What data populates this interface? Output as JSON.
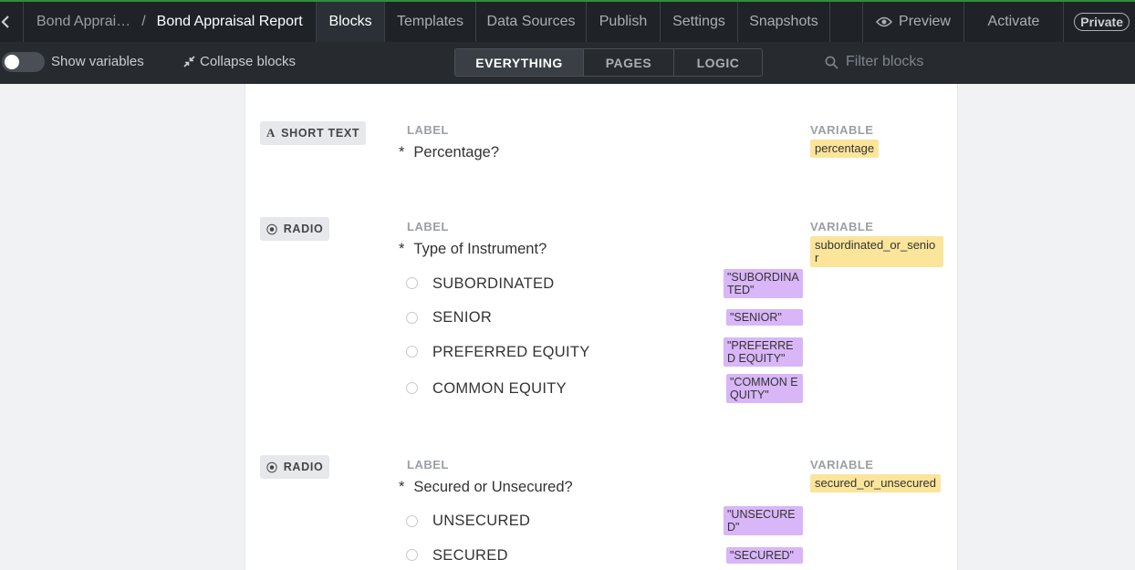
{
  "topbar": {
    "breadcrumb_parent": "Bond Apprai…",
    "breadcrumb_separator": "/",
    "breadcrumb_current": "Bond Appraisal Report",
    "tabs": [
      {
        "label": "Blocks",
        "active": true
      },
      {
        "label": "Templates"
      },
      {
        "label": "Data Sources"
      },
      {
        "label": "Publish"
      },
      {
        "label": "Settings"
      },
      {
        "label": "Snapshots"
      }
    ],
    "preview_label": "Preview",
    "activate_label": "Activate",
    "privacy_badge": "Private"
  },
  "subbar": {
    "show_variables_label": "Show variables",
    "show_variables_on": false,
    "collapse_label": "Collapse blocks",
    "views": [
      {
        "label": "EVERYTHING",
        "active": true
      },
      {
        "label": "PAGES"
      },
      {
        "label": "LOGIC"
      }
    ],
    "filter_placeholder": "Filter blocks"
  },
  "blocks": [
    {
      "type_label": "SHORT TEXT",
      "type_icon": "letter-a-icon",
      "label_caption": "LABEL",
      "required_marker": "*",
      "label": "Percentage?",
      "variable_caption": "VARIABLE",
      "variable": "percentage",
      "options": []
    },
    {
      "type_label": "RADIO",
      "type_icon": "radio-icon",
      "label_caption": "LABEL",
      "required_marker": "*",
      "label": "Type of Instrument?",
      "variable_caption": "VARIABLE",
      "variable": "subordinated_or_senior",
      "options": [
        {
          "label": "SUBORDINATED",
          "value": "\"SUBORDINATED\""
        },
        {
          "label": "SENIOR",
          "value": "\"SENIOR\""
        },
        {
          "label": "PREFERRED EQUITY",
          "value": "\"PREFERRED EQUITY\""
        },
        {
          "label": "COMMON EQUITY",
          "value": "\"COMMON EQUITY\""
        }
      ]
    },
    {
      "type_label": "RADIO",
      "type_icon": "radio-icon",
      "label_caption": "LABEL",
      "required_marker": "*",
      "label": "Secured or Unsecured?",
      "variable_caption": "VARIABLE",
      "variable": "secured_or_unsecured",
      "options": [
        {
          "label": "UNSECURED",
          "value": "\"UNSECURED\""
        },
        {
          "label": "SECURED",
          "value": "\"SECURED\""
        }
      ]
    }
  ],
  "colors": {
    "topbar_bg": "#1f2328",
    "accent_green": "#2f8f3e",
    "variable_tag": "#fbe59b",
    "option_value_tag": "#d8b6f7"
  }
}
